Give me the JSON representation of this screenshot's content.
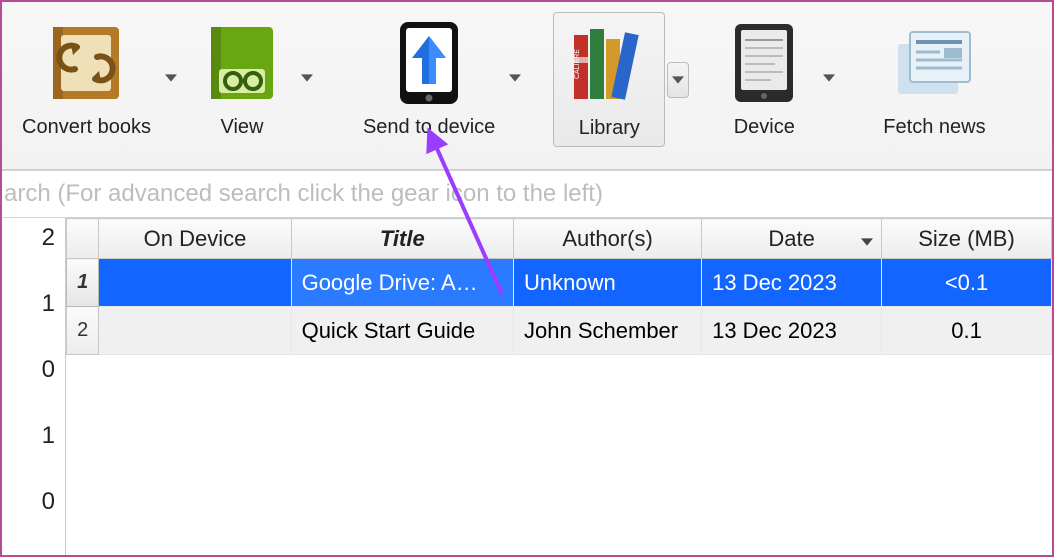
{
  "toolbar": {
    "convert_label": "Convert books",
    "view_label": "View",
    "send_label": "Send to device",
    "library_label": "Library",
    "device_label": "Device",
    "fetch_label": "Fetch news"
  },
  "search": {
    "placeholder": "arch (For advanced search click the gear icon to the left)"
  },
  "axis_labels": [
    "2",
    "1",
    "0",
    "1",
    "0"
  ],
  "columns": {
    "corner": "",
    "on_device": "On Device",
    "title": "Title",
    "authors": "Author(s)",
    "date": "Date",
    "size": "Size (MB)"
  },
  "rows": [
    {
      "num": "1",
      "on_device": "",
      "title": "Google Drive: A…",
      "authors": "Unknown",
      "date": "13 Dec 2023",
      "size": "<0.1",
      "selected": true
    },
    {
      "num": "2",
      "on_device": "",
      "title": "Quick Start Guide",
      "authors": "John Schember",
      "date": "13 Dec 2023",
      "size": "0.1",
      "selected": false
    }
  ],
  "colors": {
    "selection": "#1265ff",
    "annotation": "#9a3dff"
  }
}
